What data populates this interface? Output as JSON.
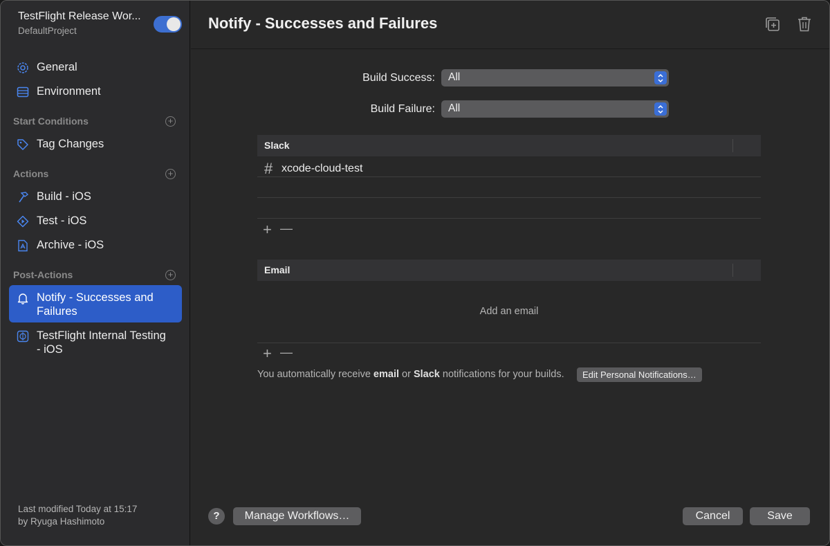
{
  "sidebar": {
    "title": "TestFlight Release Wor...",
    "subtitle": "DefaultProject",
    "toggle_on": true,
    "items_top": [
      {
        "label": "General",
        "icon": "gear-icon"
      },
      {
        "label": "Environment",
        "icon": "server-icon"
      }
    ],
    "start_conditions": {
      "label": "Start Conditions",
      "items": [
        {
          "label": "Tag Changes",
          "icon": "tag-icon"
        }
      ]
    },
    "actions": {
      "label": "Actions",
      "items": [
        {
          "label": "Build - iOS",
          "icon": "hammer-icon"
        },
        {
          "label": "Test - iOS",
          "icon": "play-diamond-icon"
        },
        {
          "label": "Archive - iOS",
          "icon": "archive-app-icon"
        }
      ]
    },
    "post_actions": {
      "label": "Post-Actions",
      "items": [
        {
          "label": "Notify - Successes and Failures",
          "icon": "bell-icon",
          "selected": true
        },
        {
          "label": "TestFlight Internal Testing - iOS",
          "icon": "testflight-icon"
        }
      ]
    },
    "footer_line1": "Last modified Today at 15:17",
    "footer_line2": "by Ryuga Hashimoto"
  },
  "main": {
    "title": "Notify - Successes and Failures",
    "build_success": {
      "label": "Build Success:",
      "value": "All"
    },
    "build_failure": {
      "label": "Build Failure:",
      "value": "All"
    },
    "slack": {
      "header": "Slack",
      "channels": [
        {
          "hash": "#",
          "name": "xcode-cloud-test"
        }
      ],
      "add_glyph": "+",
      "remove_glyph": "—"
    },
    "email": {
      "header": "Email",
      "empty_text": "Add an email",
      "add_glyph": "+",
      "remove_glyph": "—"
    },
    "notice": {
      "part1": "You automatically receive ",
      "bold1": "email",
      "part2": " or ",
      "bold2": "Slack",
      "part3": " notifications for your builds.",
      "button": "Edit Personal Notifications…"
    }
  },
  "footer": {
    "help": "?",
    "manage": "Manage Workflows…",
    "cancel": "Cancel",
    "save": "Save"
  },
  "colors": {
    "accent": "#2d5dc8",
    "toggle": "#3d6fd1",
    "icon_blue": "#4a86f0"
  }
}
